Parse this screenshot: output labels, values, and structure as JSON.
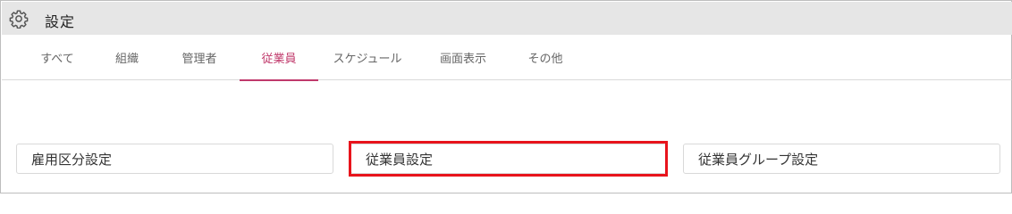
{
  "header": {
    "title": "設定",
    "icon": "gear-icon"
  },
  "tabs": [
    {
      "label": "すべて"
    },
    {
      "label": "組織"
    },
    {
      "label": "管理者"
    },
    {
      "label": "従業員",
      "active": true
    },
    {
      "label": "スケジュール"
    },
    {
      "label": "画面表示"
    },
    {
      "label": "その他"
    }
  ],
  "cards": [
    {
      "label": "雇用区分設定"
    },
    {
      "label": "従業員設定",
      "highlighted": true
    },
    {
      "label": "従業員グループ設定"
    }
  ],
  "colors": {
    "accent": "#c0396b",
    "highlight": "#e8141c",
    "header_bg": "#e6e6e6"
  }
}
